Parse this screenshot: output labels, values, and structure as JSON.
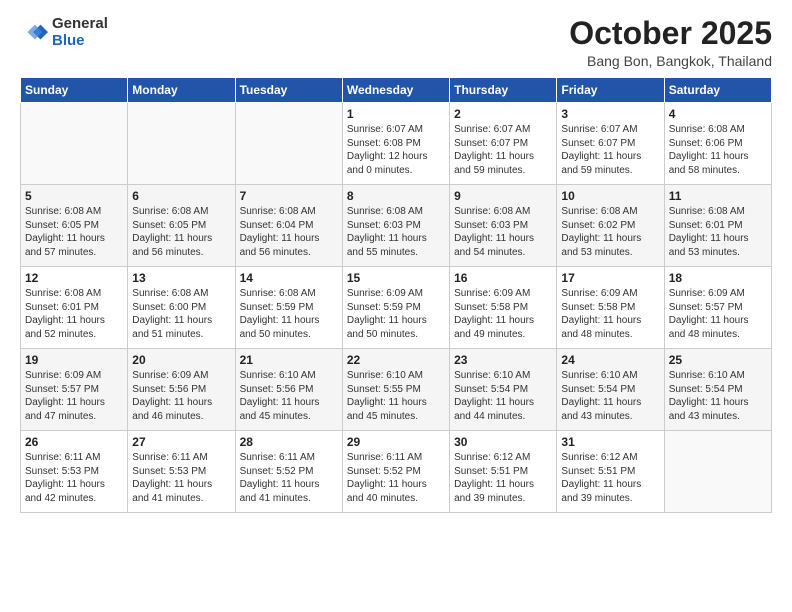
{
  "header": {
    "logo_general": "General",
    "logo_blue": "Blue",
    "month_title": "October 2025",
    "location": "Bang Bon, Bangkok, Thailand"
  },
  "days_of_week": [
    "Sunday",
    "Monday",
    "Tuesday",
    "Wednesday",
    "Thursday",
    "Friday",
    "Saturday"
  ],
  "weeks": [
    [
      {
        "day": "",
        "info": ""
      },
      {
        "day": "",
        "info": ""
      },
      {
        "day": "",
        "info": ""
      },
      {
        "day": "1",
        "info": "Sunrise: 6:07 AM\nSunset: 6:08 PM\nDaylight: 12 hours\nand 0 minutes."
      },
      {
        "day": "2",
        "info": "Sunrise: 6:07 AM\nSunset: 6:07 PM\nDaylight: 11 hours\nand 59 minutes."
      },
      {
        "day": "3",
        "info": "Sunrise: 6:07 AM\nSunset: 6:07 PM\nDaylight: 11 hours\nand 59 minutes."
      },
      {
        "day": "4",
        "info": "Sunrise: 6:08 AM\nSunset: 6:06 PM\nDaylight: 11 hours\nand 58 minutes."
      }
    ],
    [
      {
        "day": "5",
        "info": "Sunrise: 6:08 AM\nSunset: 6:05 PM\nDaylight: 11 hours\nand 57 minutes."
      },
      {
        "day": "6",
        "info": "Sunrise: 6:08 AM\nSunset: 6:05 PM\nDaylight: 11 hours\nand 56 minutes."
      },
      {
        "day": "7",
        "info": "Sunrise: 6:08 AM\nSunset: 6:04 PM\nDaylight: 11 hours\nand 56 minutes."
      },
      {
        "day": "8",
        "info": "Sunrise: 6:08 AM\nSunset: 6:03 PM\nDaylight: 11 hours\nand 55 minutes."
      },
      {
        "day": "9",
        "info": "Sunrise: 6:08 AM\nSunset: 6:03 PM\nDaylight: 11 hours\nand 54 minutes."
      },
      {
        "day": "10",
        "info": "Sunrise: 6:08 AM\nSunset: 6:02 PM\nDaylight: 11 hours\nand 53 minutes."
      },
      {
        "day": "11",
        "info": "Sunrise: 6:08 AM\nSunset: 6:01 PM\nDaylight: 11 hours\nand 53 minutes."
      }
    ],
    [
      {
        "day": "12",
        "info": "Sunrise: 6:08 AM\nSunset: 6:01 PM\nDaylight: 11 hours\nand 52 minutes."
      },
      {
        "day": "13",
        "info": "Sunrise: 6:08 AM\nSunset: 6:00 PM\nDaylight: 11 hours\nand 51 minutes."
      },
      {
        "day": "14",
        "info": "Sunrise: 6:08 AM\nSunset: 5:59 PM\nDaylight: 11 hours\nand 50 minutes."
      },
      {
        "day": "15",
        "info": "Sunrise: 6:09 AM\nSunset: 5:59 PM\nDaylight: 11 hours\nand 50 minutes."
      },
      {
        "day": "16",
        "info": "Sunrise: 6:09 AM\nSunset: 5:58 PM\nDaylight: 11 hours\nand 49 minutes."
      },
      {
        "day": "17",
        "info": "Sunrise: 6:09 AM\nSunset: 5:58 PM\nDaylight: 11 hours\nand 48 minutes."
      },
      {
        "day": "18",
        "info": "Sunrise: 6:09 AM\nSunset: 5:57 PM\nDaylight: 11 hours\nand 48 minutes."
      }
    ],
    [
      {
        "day": "19",
        "info": "Sunrise: 6:09 AM\nSunset: 5:57 PM\nDaylight: 11 hours\nand 47 minutes."
      },
      {
        "day": "20",
        "info": "Sunrise: 6:09 AM\nSunset: 5:56 PM\nDaylight: 11 hours\nand 46 minutes."
      },
      {
        "day": "21",
        "info": "Sunrise: 6:10 AM\nSunset: 5:56 PM\nDaylight: 11 hours\nand 45 minutes."
      },
      {
        "day": "22",
        "info": "Sunrise: 6:10 AM\nSunset: 5:55 PM\nDaylight: 11 hours\nand 45 minutes."
      },
      {
        "day": "23",
        "info": "Sunrise: 6:10 AM\nSunset: 5:54 PM\nDaylight: 11 hours\nand 44 minutes."
      },
      {
        "day": "24",
        "info": "Sunrise: 6:10 AM\nSunset: 5:54 PM\nDaylight: 11 hours\nand 43 minutes."
      },
      {
        "day": "25",
        "info": "Sunrise: 6:10 AM\nSunset: 5:54 PM\nDaylight: 11 hours\nand 43 minutes."
      }
    ],
    [
      {
        "day": "26",
        "info": "Sunrise: 6:11 AM\nSunset: 5:53 PM\nDaylight: 11 hours\nand 42 minutes."
      },
      {
        "day": "27",
        "info": "Sunrise: 6:11 AM\nSunset: 5:53 PM\nDaylight: 11 hours\nand 41 minutes."
      },
      {
        "day": "28",
        "info": "Sunrise: 6:11 AM\nSunset: 5:52 PM\nDaylight: 11 hours\nand 41 minutes."
      },
      {
        "day": "29",
        "info": "Sunrise: 6:11 AM\nSunset: 5:52 PM\nDaylight: 11 hours\nand 40 minutes."
      },
      {
        "day": "30",
        "info": "Sunrise: 6:12 AM\nSunset: 5:51 PM\nDaylight: 11 hours\nand 39 minutes."
      },
      {
        "day": "31",
        "info": "Sunrise: 6:12 AM\nSunset: 5:51 PM\nDaylight: 11 hours\nand 39 minutes."
      },
      {
        "day": "",
        "info": ""
      }
    ]
  ]
}
